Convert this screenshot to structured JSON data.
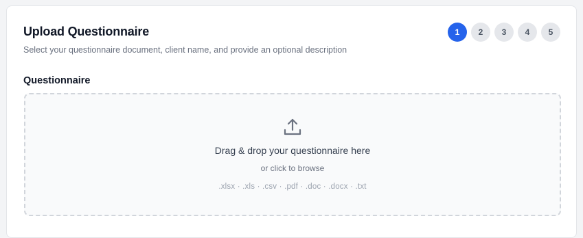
{
  "header": {
    "title": "Upload Questionnaire",
    "subtitle": "Select your questionnaire document, client name, and provide an optional description"
  },
  "stepper": {
    "steps": [
      "1",
      "2",
      "3",
      "4",
      "5"
    ],
    "active_step": "1",
    "active_color": "#2563eb"
  },
  "questionnaire": {
    "label": "Questionnaire",
    "dropzone": {
      "icon": "upload-icon",
      "title": "Drag & drop your questionnaire here",
      "browse_text": "or click to browse",
      "file_types": ".xlsx · .xls · .csv · .pdf · .doc · .docx · .txt"
    }
  }
}
